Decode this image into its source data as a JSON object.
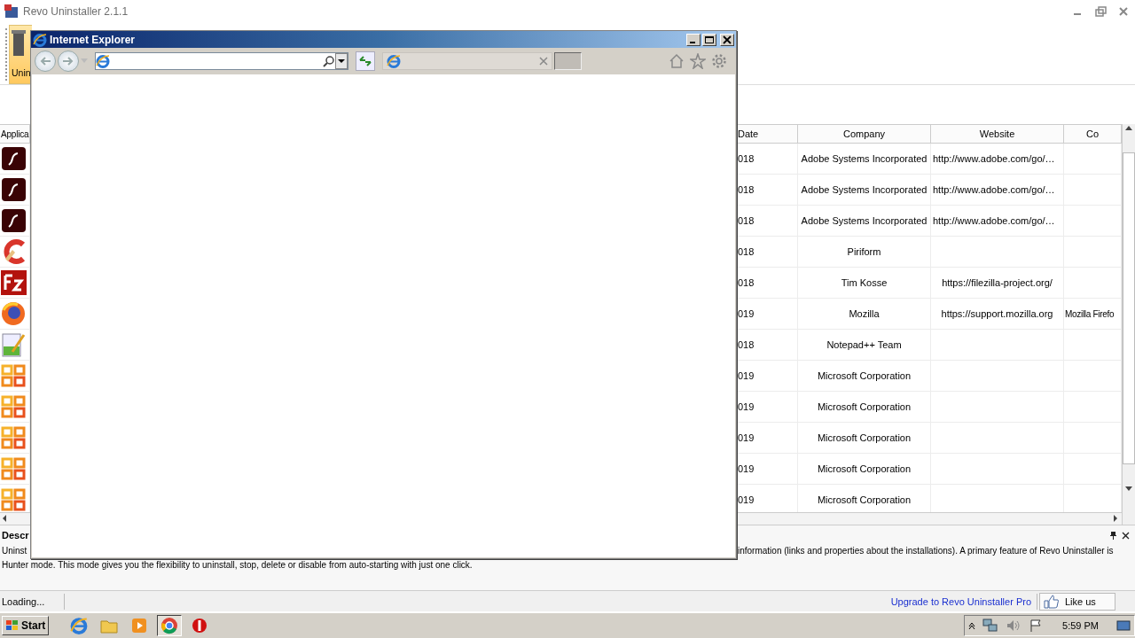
{
  "revo_window": {
    "title": "Revo Uninstaller 2.1.1",
    "toolbar": [
      {
        "label": "Unin",
        "selected": true
      }
    ],
    "table": {
      "columns": [
        "Applica",
        "Date",
        "Company",
        "Website",
        "Co"
      ],
      "rows": [
        {
          "kind": "flash",
          "date": "018",
          "company": "Adobe Systems Incorporated",
          "website": "http://www.adobe.com/go/…"
        },
        {
          "kind": "flash",
          "date": "018",
          "company": "Adobe Systems Incorporated",
          "website": "http://www.adobe.com/go/…"
        },
        {
          "kind": "flash",
          "date": "018",
          "company": "Adobe Systems Incorporated",
          "website": "http://www.adobe.com/go/…"
        },
        {
          "kind": "ccleaner",
          "date": "018",
          "company": "Piriform"
        },
        {
          "kind": "filezilla",
          "date": "018",
          "company": "Tim Kosse",
          "website": "https://filezilla-project.org/"
        },
        {
          "kind": "firefox",
          "date": "019",
          "company": "Mozilla",
          "website": "https://support.mozilla.org",
          "column_4": "Mozilla Firefo"
        },
        {
          "kind": "notepad",
          "date": "018",
          "company": "Notepad++ Team"
        },
        {
          "kind": "office",
          "date": "019",
          "company": "Microsoft Corporation"
        },
        {
          "kind": "office",
          "date": "019",
          "company": "Microsoft Corporation"
        },
        {
          "kind": "office",
          "date": "019",
          "company": "Microsoft Corporation"
        },
        {
          "kind": "office",
          "date": "019",
          "company": "Microsoft Corporation"
        },
        {
          "kind": "office",
          "date": "019",
          "company": "Microsoft Corporation"
        }
      ]
    },
    "description": {
      "title": "Descr",
      "line_1_start": "Uninst",
      "line_1_end": "information (links and properties about the installations). A primary feature of Revo Uninstaller is",
      "line_2": "Hunter mode. This mode gives you the flexibility to uninstall, stop, delete or disable from auto-starting with just one click."
    },
    "status_bar": {
      "text": "Loading...",
      "link": "Upgrade to Revo Uninstaller Pro",
      "like_button": "Like us"
    }
  },
  "browser_window": {
    "title": "Internet Explorer"
  },
  "taskbar": {
    "start": "Start",
    "apps": [
      {
        "kind": "ie",
        "selected": false
      },
      {
        "kind": "folder",
        "selected": false
      },
      {
        "kind": "media",
        "selected": false
      },
      {
        "kind": "chrome",
        "selected": true
      },
      {
        "kind": "stop",
        "selected": false
      }
    ],
    "clock": "5:59 PM"
  }
}
